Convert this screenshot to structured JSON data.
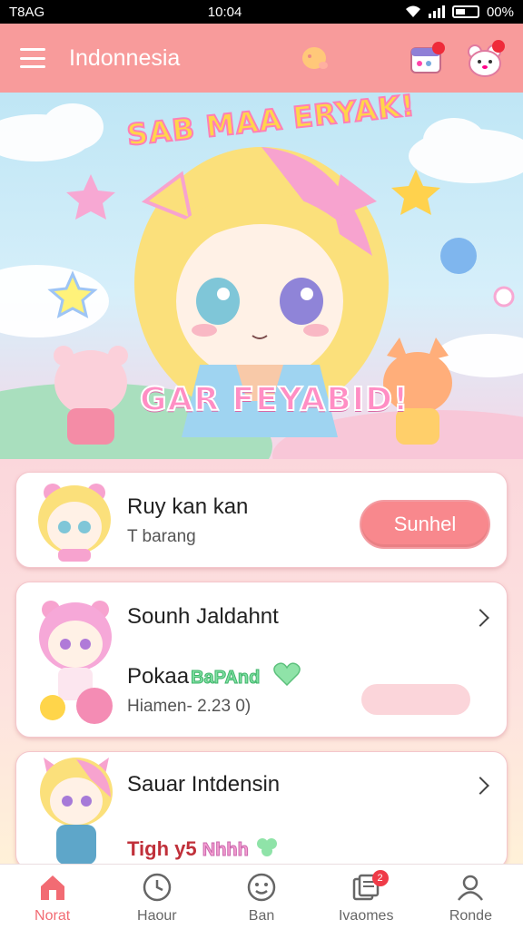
{
  "status_bar": {
    "carrier": "T8AG",
    "time": "10:04",
    "battery": "00%"
  },
  "app_bar": {
    "title": "Indonnesia"
  },
  "banner": {
    "title": "SAB MAA ERYAK!",
    "subtitle": "GAR FEYABID!"
  },
  "cards": [
    {
      "title": "Ruy kan kan",
      "subtitle": "T barang",
      "button_label": "Sunhel"
    },
    {
      "title": "Sounh Jaldahnt",
      "line2_text": "Pokaa",
      "line2_tag": "BaPAnd",
      "meta": "Hiamen- 2.23 0)"
    },
    {
      "title": "Sauar Intdensin",
      "line2_text": "Tigh y5",
      "line2_tag": "Nhhh"
    }
  ],
  "bottom_nav": {
    "items": [
      {
        "label": "Norat",
        "icon": "home-icon",
        "active": true
      },
      {
        "label": "Haour",
        "icon": "clock-icon",
        "active": false
      },
      {
        "label": "Ban",
        "icon": "smiley-icon",
        "active": false
      },
      {
        "label": "Ivaomes",
        "icon": "messages-icon",
        "active": false,
        "badge": "2"
      },
      {
        "label": "Ronde",
        "icon": "profile-icon",
        "active": false
      }
    ]
  },
  "colors": {
    "app_bar": "#f89b9b",
    "primary_button": "#f8888d",
    "active_nav": "#f26b73",
    "badge": "#ef3b48"
  }
}
